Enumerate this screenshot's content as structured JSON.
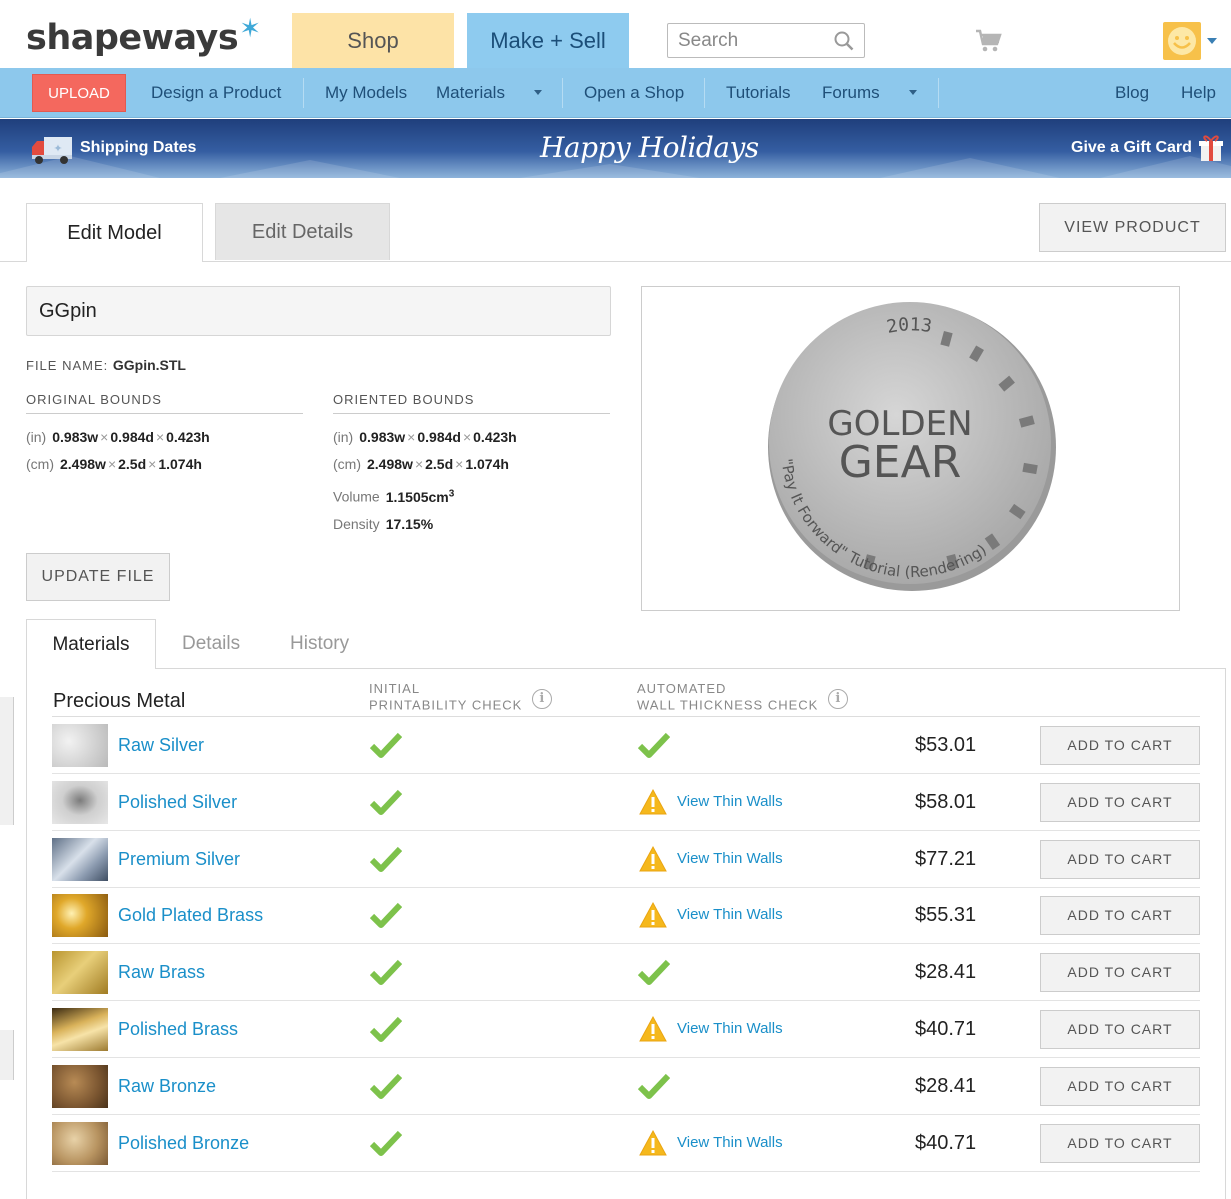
{
  "header": {
    "logo": "shapeways",
    "shop_tab": "Shop",
    "make_sell_tab": "Make + Sell",
    "search_placeholder": "Search"
  },
  "nav": {
    "upload": "UPLOAD",
    "items": [
      "Design a Product",
      "My Models",
      "Materials",
      "Open a Shop",
      "Tutorials",
      "Forums"
    ],
    "blog": "Blog",
    "help": "Help"
  },
  "banner": {
    "shipping": "Shipping Dates",
    "title": "Happy Holidays",
    "gift": "Give a Gift Card"
  },
  "tabs": {
    "edit_model": "Edit Model",
    "edit_details": "Edit Details",
    "view_product": "VIEW PRODUCT"
  },
  "model": {
    "name": "GGpin",
    "file_label": "FILE NAME:",
    "file_name": "GGpin.STL",
    "original_bounds_label": "ORIGINAL BOUNDS",
    "oriented_bounds_label": "ORIENTED BOUNDS",
    "original": {
      "in": {
        "unit": "(in)",
        "w": "0.983w",
        "d": "0.984d",
        "h": "0.423h"
      },
      "cm": {
        "unit": "(cm)",
        "w": "2.498w",
        "d": "2.5d",
        "h": "1.074h"
      }
    },
    "oriented": {
      "in": {
        "unit": "(in)",
        "w": "0.983w",
        "d": "0.984d",
        "h": "0.423h"
      },
      "cm": {
        "unit": "(cm)",
        "w": "2.498w",
        "d": "2.5d",
        "h": "1.074h"
      }
    },
    "volume_label": "Volume",
    "volume_value": "1.1505cm",
    "volume_exp": "3",
    "density_label": "Density",
    "density_value": "17.15%",
    "update_file": "UPDATE FILE",
    "preview": {
      "line1": "GOLDEN",
      "line2": "GEAR",
      "year": "2013",
      "ring_text": "\"Pay It Forward\" Tutorial (Rendering)"
    }
  },
  "lower_tabs": {
    "materials": "Materials",
    "details": "Details",
    "history": "History"
  },
  "materials": {
    "section": "Precious Metal",
    "col_initial_1": "INITIAL",
    "col_initial_2": "PRINTABILITY CHECK",
    "col_auto_1": "AUTOMATED",
    "col_auto_2": "WALL THICKNESS CHECK",
    "thin_walls_label": "View Thin Walls",
    "add_to_cart_label": "ADD TO CART",
    "rows": [
      {
        "name": "Raw Silver",
        "wall": "ok",
        "price": "$53.01"
      },
      {
        "name": "Polished Silver",
        "wall": "warn",
        "price": "$58.01"
      },
      {
        "name": "Premium Silver",
        "wall": "warn",
        "price": "$77.21"
      },
      {
        "name": "Gold Plated Brass",
        "wall": "warn",
        "price": "$55.31"
      },
      {
        "name": "Raw Brass",
        "wall": "ok",
        "price": "$28.41"
      },
      {
        "name": "Polished Brass",
        "wall": "warn",
        "price": "$40.71"
      },
      {
        "name": "Raw Bronze",
        "wall": "ok",
        "price": "$28.41"
      },
      {
        "name": "Polished Bronze",
        "wall": "warn",
        "price": "$40.71"
      }
    ]
  },
  "colors": {
    "accent_blue": "#1a8fc9",
    "nav_blue": "#8dc8ec",
    "upload_red": "#f4685e",
    "check_green": "#7dc24b",
    "warn_yellow": "#f5b81c"
  }
}
